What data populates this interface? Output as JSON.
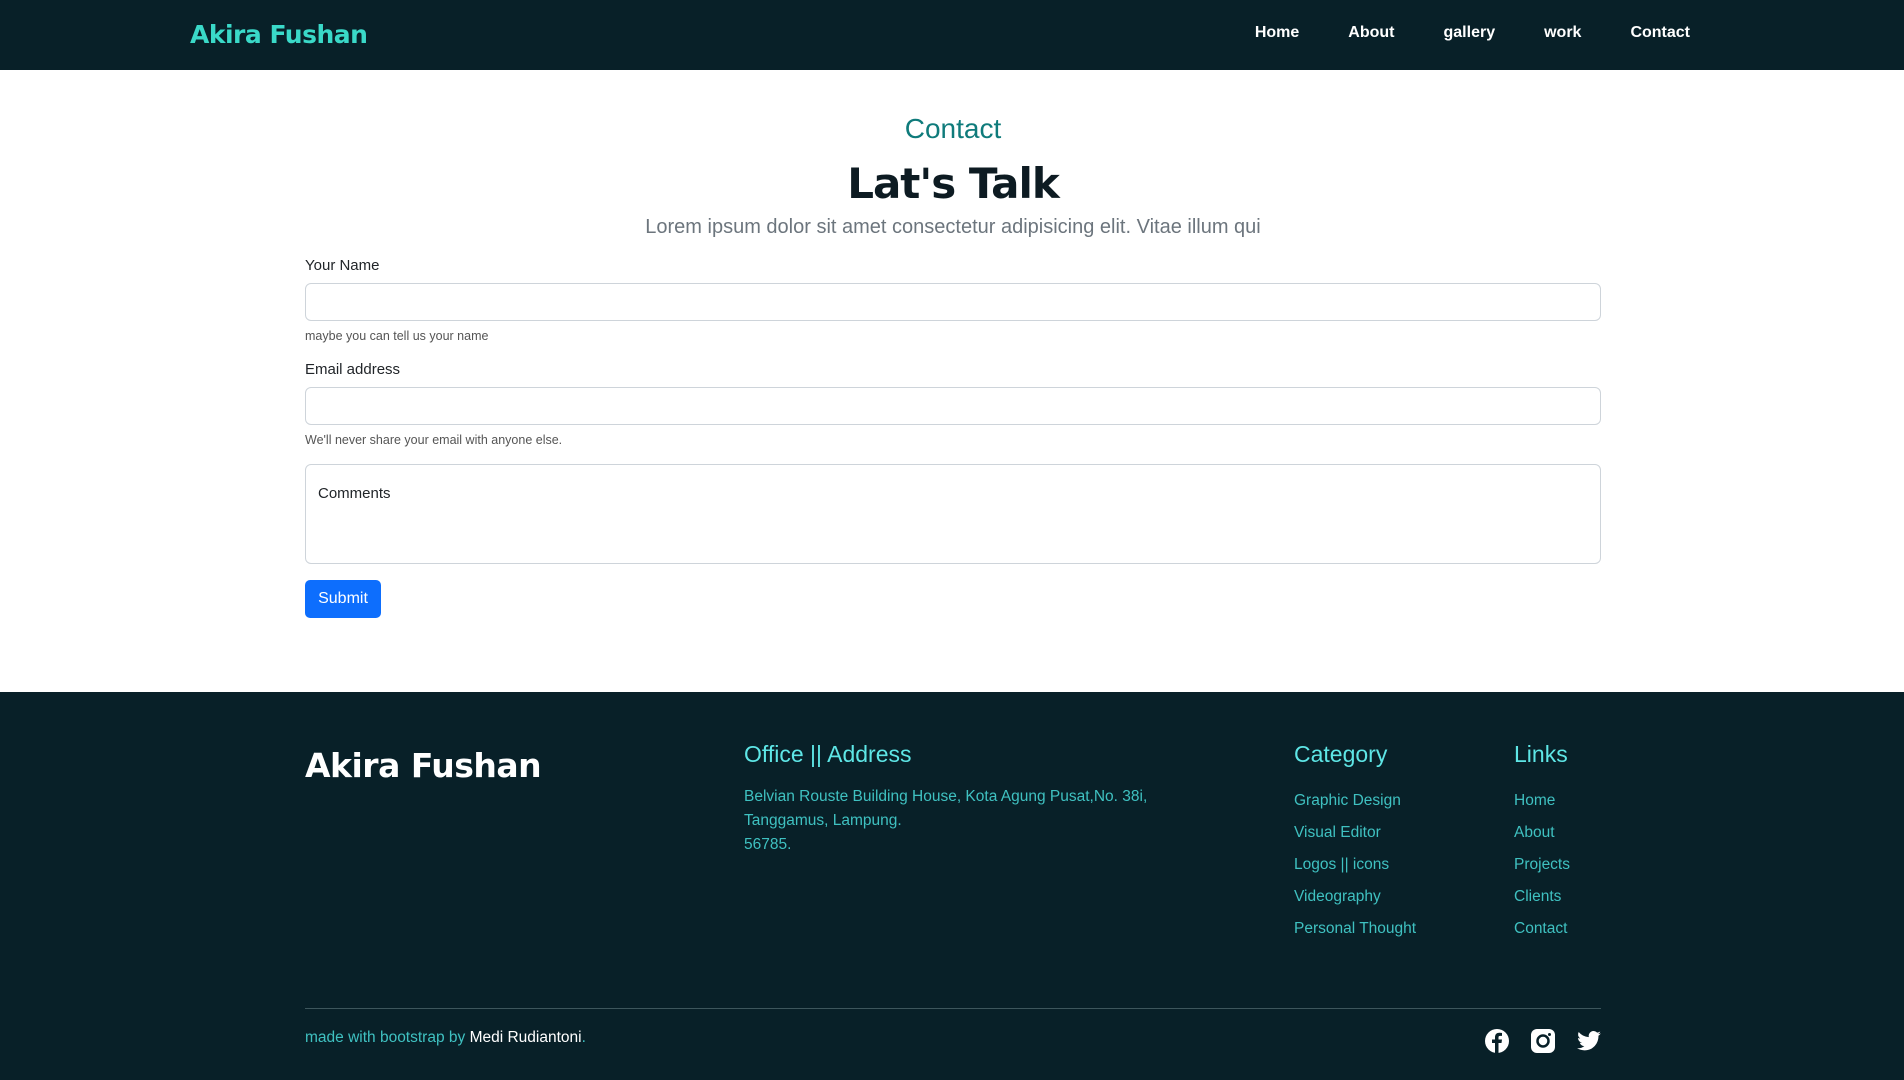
{
  "nav": {
    "brand": "Akira Fushan",
    "items": [
      "Home",
      "About",
      "gallery",
      "work",
      "Contact"
    ]
  },
  "hero": {
    "section": "Contact",
    "title": "Lat's Talk",
    "lead": "Lorem ipsum dolor sit amet consectetur adipisicing elit. Vitae illum qui"
  },
  "form": {
    "name_label": "Your Name",
    "name_help": "maybe you can tell us your name",
    "email_label": "Email address",
    "email_help": "We'll never share your email with anyone else.",
    "comments_placeholder": "Comments",
    "submit": "Submit"
  },
  "footer": {
    "brand": "Akira Fushan",
    "office_title": "Office || Address",
    "address": [
      "Belvian Rouste Building House, Kota Agung Pusat,No. 38i,",
      "Tanggamus, Lampung.",
      "56785."
    ],
    "category_title": "Category",
    "categories": [
      "Graphic Design",
      "Visual Editor",
      "Logos || icons",
      "Videography",
      "Personal Thought"
    ],
    "links_title": "Links",
    "links": [
      "Home",
      "About",
      "Projects",
      "Clients",
      "Contact"
    ],
    "credit_prefix": "made with bootstrap by ",
    "credit_name": "Medi Rudiantoni",
    "credit_suffix": ".",
    "social": [
      "facebook-icon",
      "instagram-icon",
      "twitter-icon"
    ]
  }
}
